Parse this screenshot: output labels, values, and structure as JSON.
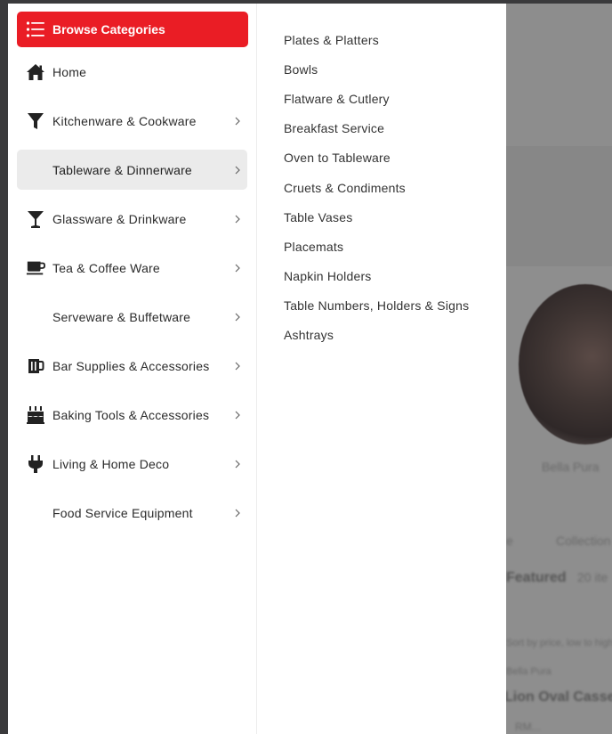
{
  "menu": {
    "browse_label": "Browse Categories",
    "categories": [
      {
        "label": "Home",
        "icon": "home-icon",
        "has_submenu": false,
        "active": false
      },
      {
        "label": "Kitchenware & Cookware",
        "icon": "funnel-icon",
        "has_submenu": true,
        "active": false
      },
      {
        "label": "Tableware & Dinnerware",
        "icon": "",
        "has_submenu": true,
        "active": true
      },
      {
        "label": "Glassware & Drinkware",
        "icon": "cocktail-glass-icon",
        "has_submenu": true,
        "active": false
      },
      {
        "label": "Tea & Coffee Ware",
        "icon": "coffee-cup-icon",
        "has_submenu": true,
        "active": false
      },
      {
        "label": "Serveware & Buffetware",
        "icon": "",
        "has_submenu": true,
        "active": false
      },
      {
        "label": "Bar Supplies & Accessories",
        "icon": "beer-mug-icon",
        "has_submenu": true,
        "active": false
      },
      {
        "label": "Baking Tools & Accessories",
        "icon": "birthday-cake-icon",
        "has_submenu": true,
        "active": false
      },
      {
        "label": "Living & Home Deco",
        "icon": "plug-icon",
        "has_submenu": true,
        "active": false
      },
      {
        "label": "Food Service Equipment",
        "icon": "",
        "has_submenu": true,
        "active": false
      }
    ],
    "submenu": [
      "Plates & Platters",
      "Bowls",
      "Flatware & Cutlery",
      "Breakfast Service",
      "Oven to Tableware",
      "Cruets & Condiments",
      "Table Vases",
      "Placemats",
      "Napkin Holders",
      "Table Numbers, Holders & Signs",
      "Ashtrays"
    ]
  },
  "background": {
    "texts": [
      "Bella Pura",
      "e",
      "Collection",
      "Featured",
      "20 ite",
      "Sort by price, low to high",
      "Bella Pura",
      "Lion Oval Casserole",
      "RM..."
    ]
  },
  "colors": {
    "accent": "#ea1d25",
    "active_bg": "#ebebeb",
    "overlay": "#8e8e8e"
  }
}
